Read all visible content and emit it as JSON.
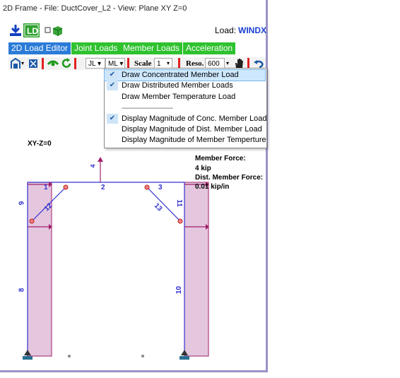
{
  "window": {
    "title": "2D Frame - File: DuctCover_L2 - View: Plane XY Z=0"
  },
  "toolbar_top": {
    "load_label": "Load:",
    "load_value": "WINDX"
  },
  "tabs": [
    {
      "label": "2D Load Editor"
    },
    {
      "label": "Joint Loads"
    },
    {
      "label": "Member Loads"
    },
    {
      "label": "Acceleration"
    }
  ],
  "toolbar": {
    "jl_label": "JL",
    "ml_label": "ML",
    "scale_label": "Scale",
    "scale_value": "1",
    "reso_label": "Reso.",
    "reso_value": "600"
  },
  "menu": {
    "items": [
      {
        "label": "Draw Concentrated Member Load",
        "checked": true
      },
      {
        "label": "Draw Distributed Member Loads",
        "checked": true
      },
      {
        "label": "Draw Member Temperature Load",
        "checked": false
      },
      {
        "label": "Display Magnitude of Conc. Member Load",
        "checked": true
      },
      {
        "label": "Display Magnitude of Dist. Member Load",
        "checked": false
      },
      {
        "label": "Display Magnitude of Member Temperture",
        "checked": false
      }
    ],
    "separator": "-------------------------------"
  },
  "canvas": {
    "plane_label": "XY-Z=0",
    "legend_line1": "Member Force:",
    "legend_line2": "4  kip",
    "legend_line3": "Dist. Member Force:",
    "legend_line4": "0.01  kip/in",
    "load_value_label": "4",
    "member_labels": [
      "1",
      "2",
      "3",
      "6",
      "12",
      "13",
      "11",
      "8",
      "10"
    ]
  },
  "colors": {
    "accent": "#2a7bd8",
    "tab_green": "#2fc22f",
    "load": "#a0206a",
    "frame": "#3030d0"
  }
}
